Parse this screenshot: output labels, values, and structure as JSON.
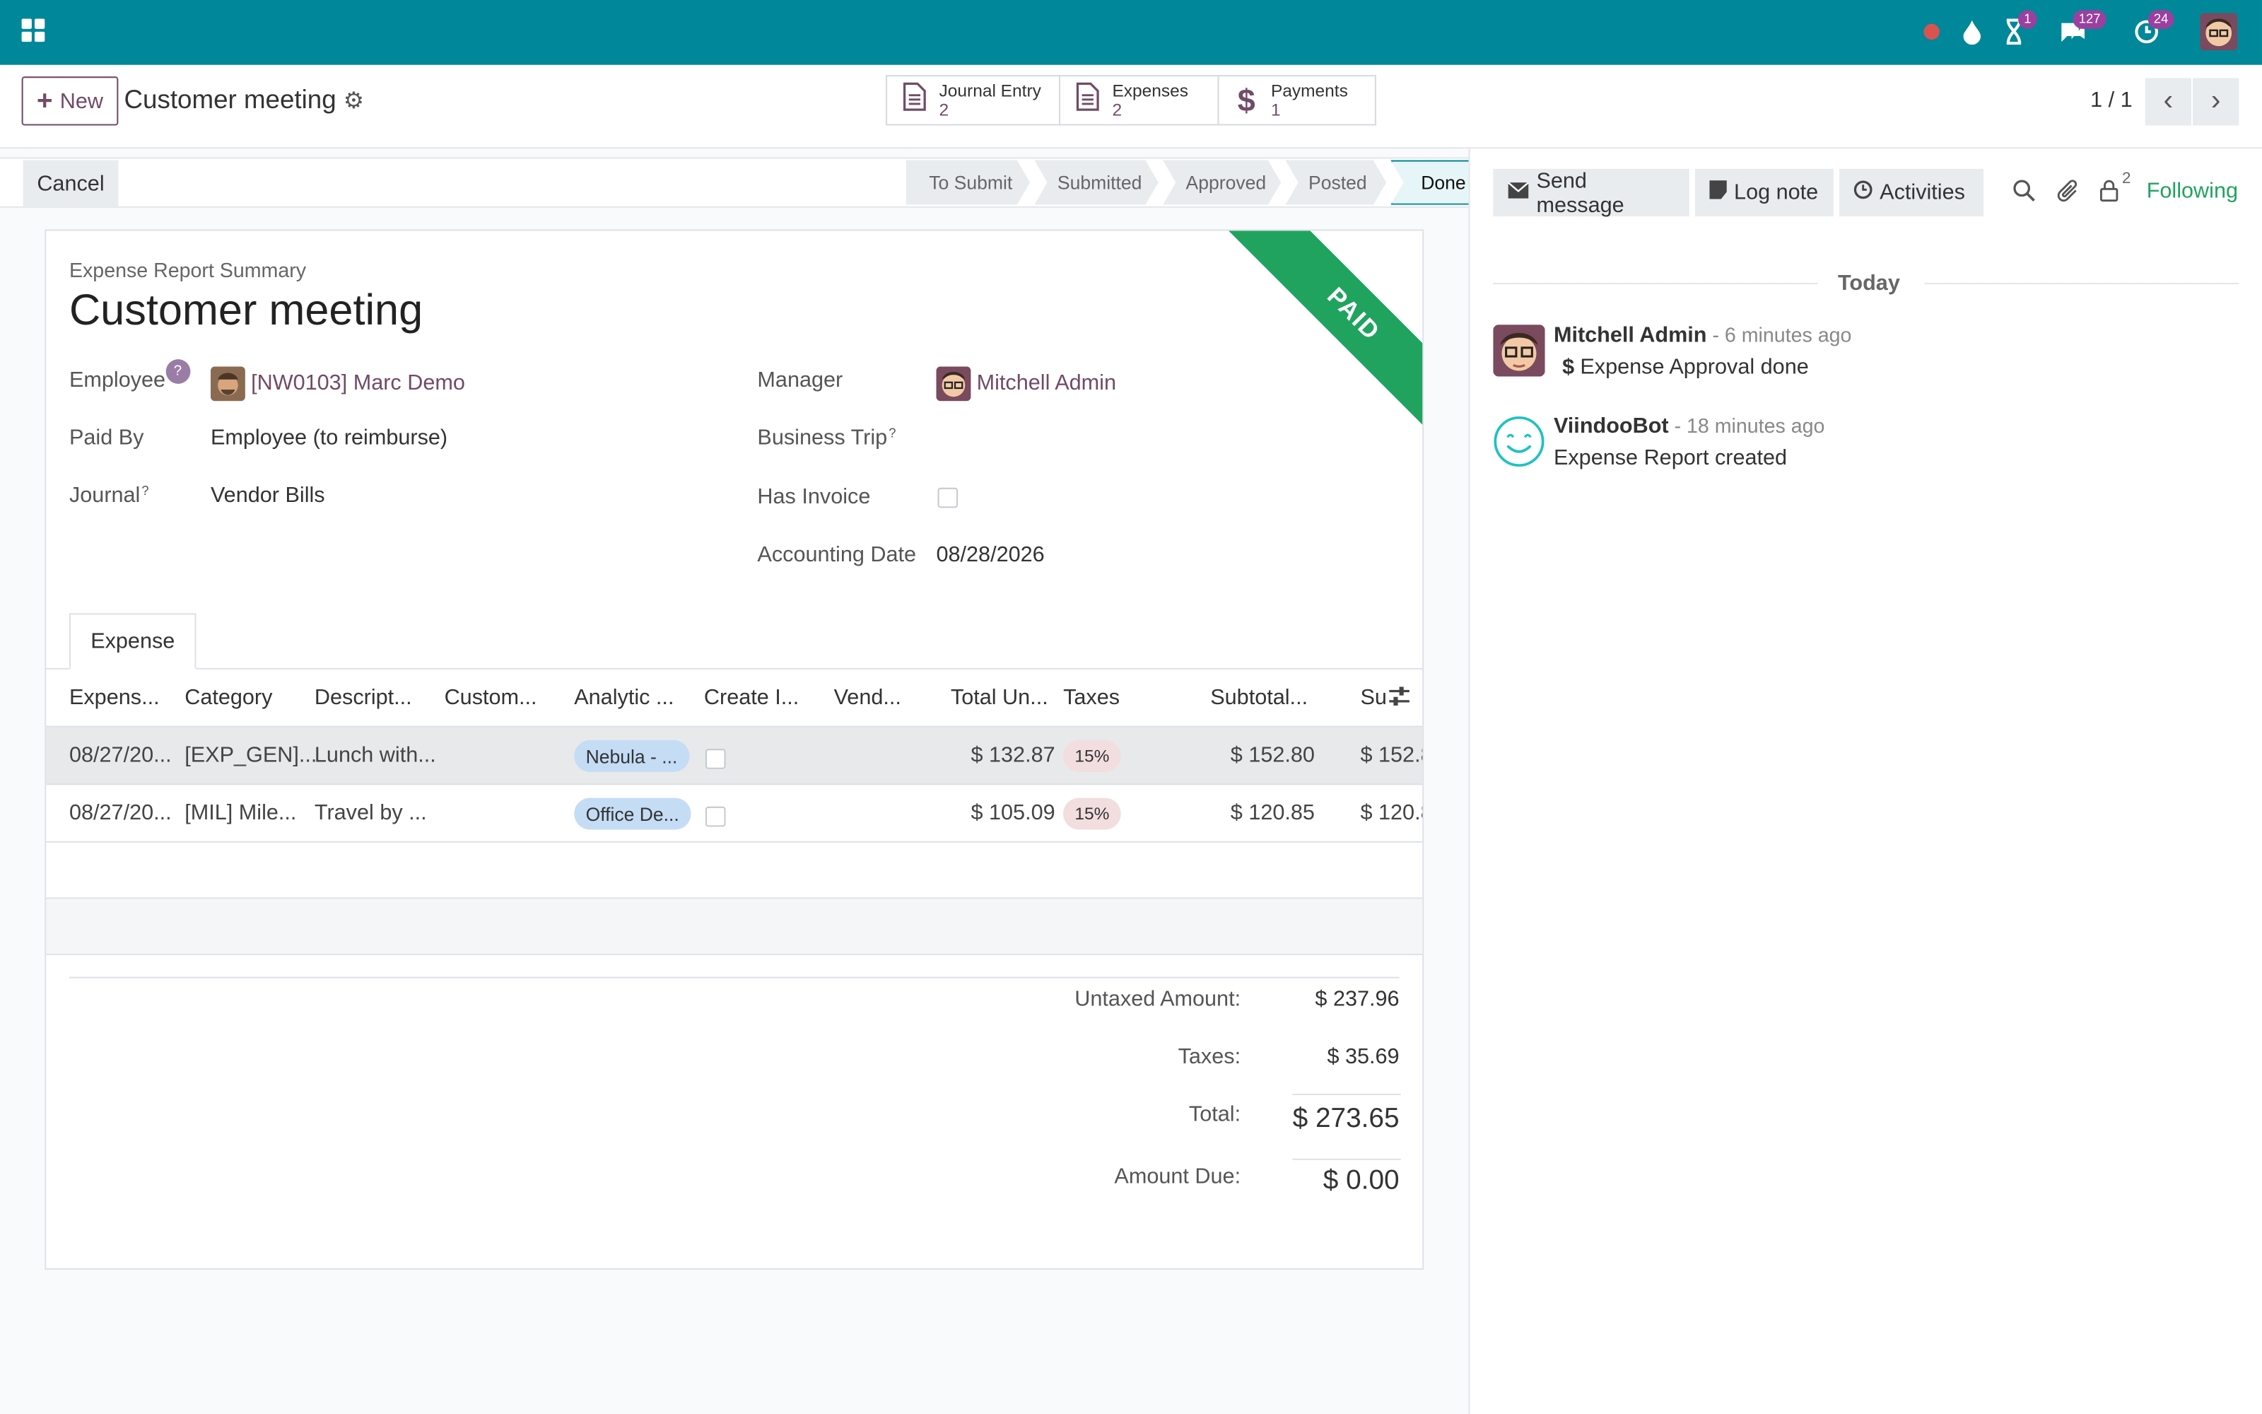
{
  "topbar": {
    "badges": {
      "activities": "1",
      "messages": "127",
      "timer": "24"
    }
  },
  "control": {
    "new_label": "New",
    "record_title": "Customer meeting",
    "smart_buttons": [
      {
        "label": "Journal Entry",
        "count": "2",
        "icon": "document-icon"
      },
      {
        "label": "Expenses",
        "count": "2",
        "icon": "document-icon"
      },
      {
        "label": "Payments",
        "count": "1",
        "icon": "dollar-icon"
      }
    ],
    "pager": "1 / 1"
  },
  "statusbar": {
    "cancel_label": "Cancel",
    "stages": [
      "To Submit",
      "Submitted",
      "Approved",
      "Posted",
      "Done"
    ],
    "active_stage": "Done"
  },
  "sheet": {
    "ribbon": "PAID",
    "summary_label": "Expense Report Summary",
    "title": "Customer meeting",
    "fields": {
      "employee_label": "Employee",
      "employee_help": "?",
      "employee_value": "[NW0103] Marc Demo",
      "paid_by_label": "Paid By",
      "paid_by_value": "Employee (to reimburse)",
      "journal_label": "Journal",
      "journal_value": "Vendor Bills",
      "manager_label": "Manager",
      "manager_value": "Mitchell Admin",
      "business_trip_label": "Business Trip",
      "has_invoice_label": "Has Invoice",
      "accounting_date_label": "Accounting Date",
      "accounting_date_value": "08/28/2026",
      "help_mark": "?"
    },
    "tab": "Expense",
    "table": {
      "headers": [
        "Expens...",
        "Category",
        "Descript...",
        "Custom...",
        "Analytic ...",
        "Create I...",
        "Vend...",
        "Total Un...",
        "Taxes",
        "Subtotal...",
        "Su"
      ],
      "rows": [
        {
          "date": "08/27/20...",
          "category": "[EXP_GEN]...",
          "description": "Lunch with...",
          "analytic": "Nebula - ...",
          "total": "$ 132.87",
          "tax": "15%",
          "subtotal": "$ 152.80",
          "sub2": "$ 152.8"
        },
        {
          "date": "08/27/20...",
          "category": "[MIL] Mile...",
          "description": "Travel by ...",
          "analytic": "Office De...",
          "total": "$ 105.09",
          "tax": "15%",
          "subtotal": "$ 120.85",
          "sub2": "$ 120.8"
        }
      ]
    },
    "totals": {
      "untaxed_label": "Untaxed Amount:",
      "untaxed_value": "$ 237.96",
      "taxes_label": "Taxes:",
      "taxes_value": "$ 35.69",
      "total_label": "Total:",
      "total_value": "$ 273.65",
      "due_label": "Amount Due:",
      "due_value": "$ 0.00"
    }
  },
  "chatter": {
    "send_message": "Send message",
    "log_note": "Log note",
    "activities": "Activities",
    "followers_count": "2",
    "following": "Following",
    "date_separator": "Today",
    "messages": [
      {
        "author": "Mitchell Admin",
        "time": " - 6 minutes ago",
        "body": "Expense Approval done"
      },
      {
        "author": "ViindooBot",
        "time": " - 18 minutes ago",
        "body": "Expense Report created"
      }
    ]
  },
  "colors": {
    "topbar": "#00879a",
    "brand": "#714b67",
    "paid": "#21a360",
    "following": "#21a360"
  }
}
